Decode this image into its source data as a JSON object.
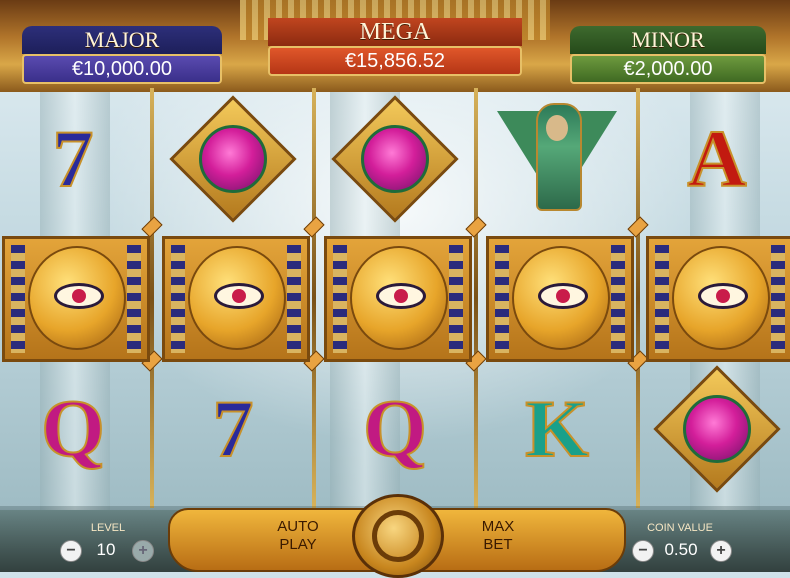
{
  "jackpots": {
    "major": {
      "name": "MAJOR",
      "amount": "€10,000.00"
    },
    "mega": {
      "name": "MEGA",
      "amount": "€15,856.52"
    },
    "minor": {
      "name": "MINOR",
      "amount": "€2,000.00"
    }
  },
  "reels": {
    "row1": [
      "seven",
      "scarab",
      "scarab",
      "pharaoh",
      "ace"
    ],
    "row2": [
      "eye-of-horus",
      "eye-of-horus",
      "eye-of-horus",
      "eye-of-horus",
      "eye-of-horus"
    ],
    "row3": [
      "queen",
      "seven",
      "queen",
      "king",
      "scarab"
    ],
    "letters": {
      "seven": "7",
      "ace": "A",
      "queen": "Q",
      "king": "K"
    }
  },
  "controls": {
    "level_label": "LEVEL",
    "level_value": "10",
    "auto_play": "AUTO\nPLAY",
    "auto_play_line1": "AUTO",
    "auto_play_line2": "PLAY",
    "max_bet_line1": "MAX",
    "max_bet_line2": "BET",
    "coin_label": "COIN VALUE",
    "coin_value": "0.50",
    "minus": "−",
    "plus": "+"
  },
  "colors": {
    "major": "#2d2f7a",
    "mega": "#c0451f",
    "minor": "#3e6a2e",
    "gold": "#e3a43a"
  }
}
